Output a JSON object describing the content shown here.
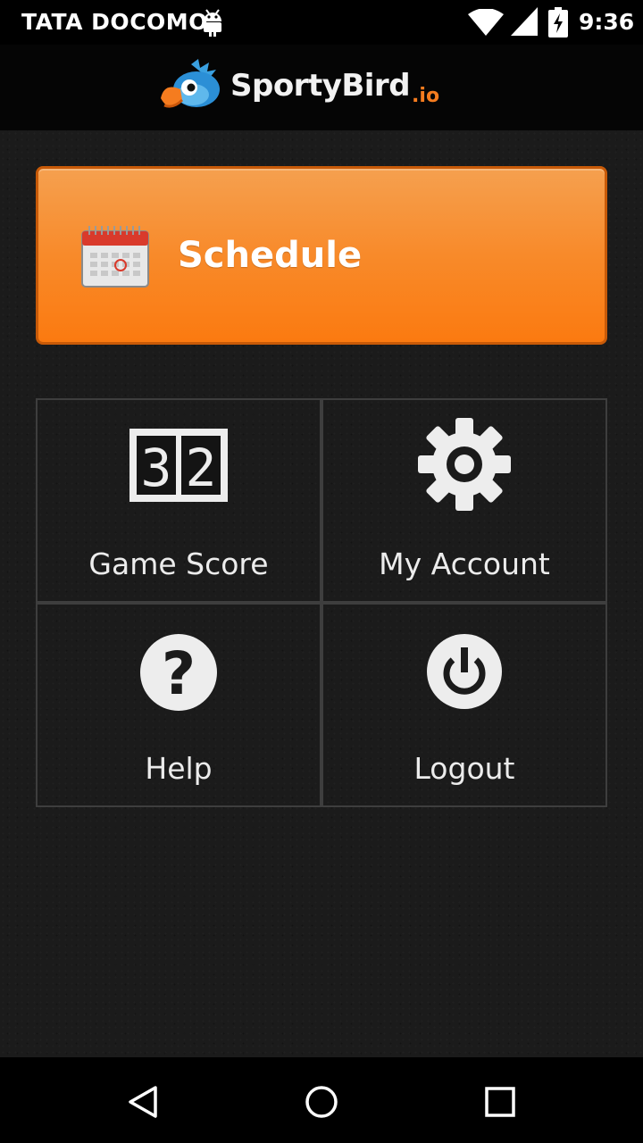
{
  "status_bar": {
    "carrier": "TATA DOCOMO",
    "time": "9:36",
    "icons": [
      "android-debug-icon",
      "wifi-icon",
      "signal-icon",
      "battery-charging-icon"
    ]
  },
  "header": {
    "logo_text": "SportyBird",
    "logo_suffix": ".io"
  },
  "schedule": {
    "label": "Schedule",
    "icon": "calendar-icon",
    "color": "#f88a2a"
  },
  "menu": [
    {
      "label": "Game Score",
      "icon": "scoreboard-icon",
      "score_left": "3",
      "score_right": "2"
    },
    {
      "label": "My Account",
      "icon": "gear-icon"
    },
    {
      "label": "Help",
      "icon": "help-icon"
    },
    {
      "label": "Logout",
      "icon": "power-icon"
    }
  ],
  "nav_bar": {
    "icons": [
      "back-icon",
      "home-icon",
      "recents-icon"
    ]
  }
}
